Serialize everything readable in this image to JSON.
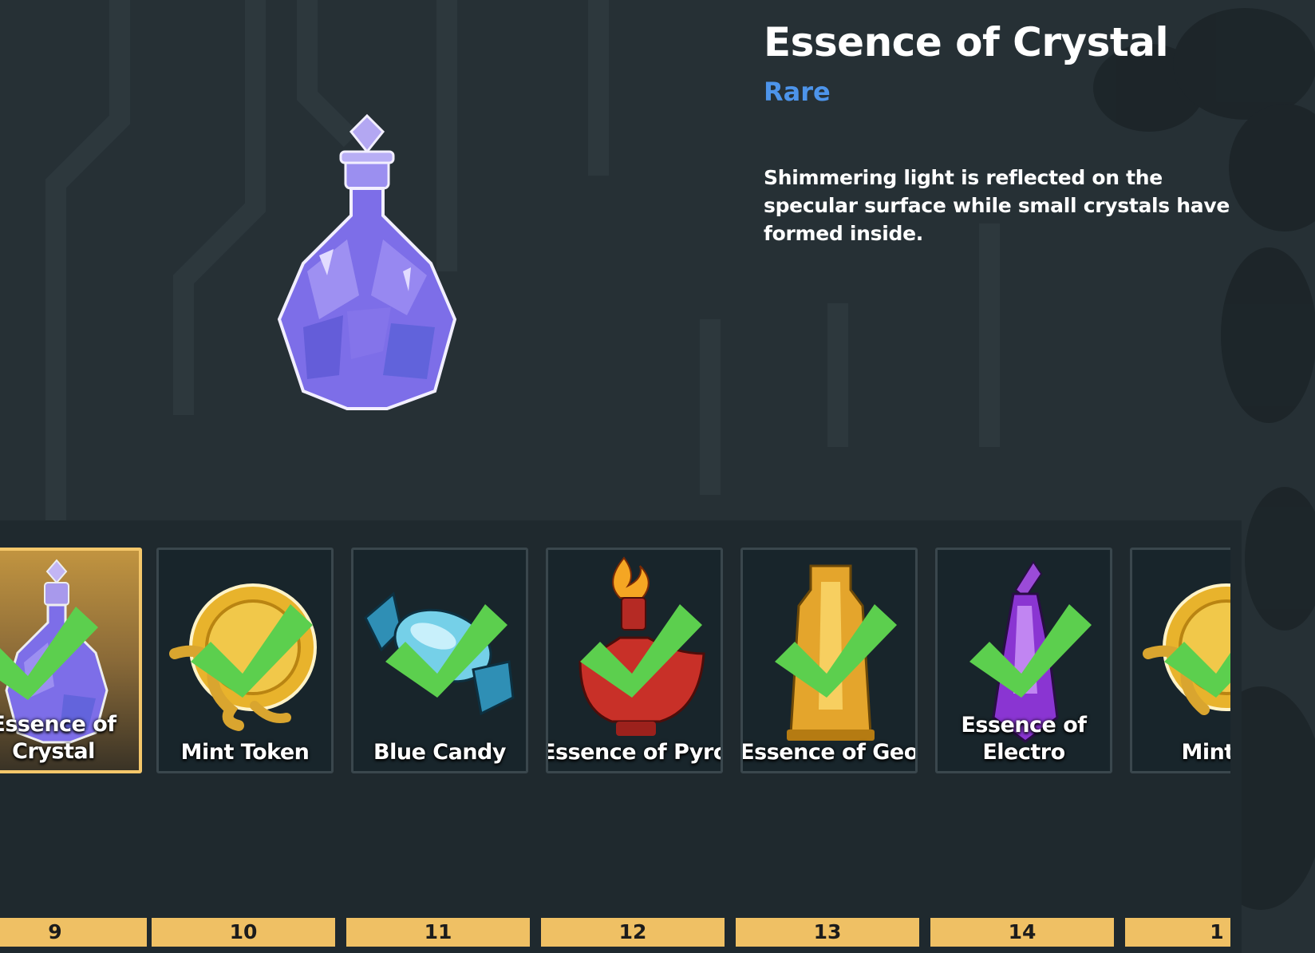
{
  "item": {
    "name": "Essence of Crystal",
    "rarity": "Rare",
    "rarity_color": "#4d94ea",
    "description": "Shimmering light is reflected on the specular surface while small crystals have formed inside.",
    "icon": "crystal-potion-icon"
  },
  "inventory": {
    "items": [
      {
        "label": "Essence of Crystal",
        "number": "9",
        "icon": "crystal-potion-icon",
        "selected": true,
        "collected": true
      },
      {
        "label": "Mint Token",
        "number": "10",
        "icon": "mint-token-icon",
        "selected": false,
        "collected": true
      },
      {
        "label": "Blue Candy",
        "number": "11",
        "icon": "blue-candy-icon",
        "selected": false,
        "collected": true
      },
      {
        "label": "Essence of Pyro",
        "number": "12",
        "icon": "pyro-essence-icon",
        "selected": false,
        "collected": true
      },
      {
        "label": "Essence of Geo",
        "number": "13",
        "icon": "geo-essence-icon",
        "selected": false,
        "collected": true
      },
      {
        "label": "Essence of Electro",
        "number": "14",
        "icon": "electro-essence-icon",
        "selected": false,
        "collected": true
      },
      {
        "label": "Mint T",
        "number": "1",
        "icon": "mint-token-icon",
        "selected": false,
        "collected": true
      }
    ]
  },
  "colors": {
    "selected_border": "#f5c76a",
    "number_bar": "#efc064",
    "checkmark": "#5ccf4e"
  }
}
